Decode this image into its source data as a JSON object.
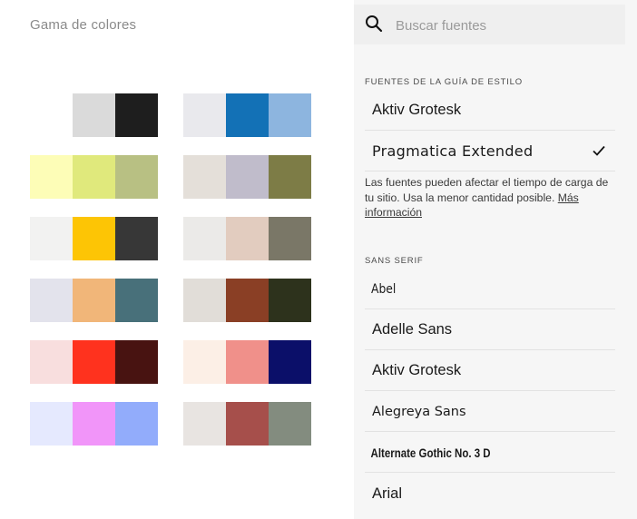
{
  "left_panel": {
    "title": "Gama de colores",
    "palettes": [
      [
        "#ffffff",
        "#dadada",
        "#1e1e1e"
      ],
      [
        "#e9e9ed",
        "#1371b6",
        "#8db5df"
      ],
      [
        "#fdfdb7",
        "#e0e97c",
        "#b8c083"
      ],
      [
        "#e4dfd9",
        "#c0bccb",
        "#7d7c46"
      ],
      [
        "#f2f2f1",
        "#fdc505",
        "#373737"
      ],
      [
        "#ebeae8",
        "#e2ccbf",
        "#7a7767"
      ],
      [
        "#e3e3ec",
        "#f1b679",
        "#48707a"
      ],
      [
        "#e1ddd8",
        "#8a3f25",
        "#2d321c"
      ],
      [
        "#f8dede",
        "#ff321e",
        "#481311"
      ],
      [
        "#fcefe6",
        "#f0908a",
        "#0b0f69"
      ],
      [
        "#e5e9fe",
        "#f195f9",
        "#92acfb"
      ],
      [
        "#e8e4e1",
        "#a64f4b",
        "#838c7f"
      ]
    ]
  },
  "search": {
    "placeholder": "Buscar fuentes",
    "value": ""
  },
  "style_guide": {
    "label": "FUENTES DE LA GUÍA DE ESTILO",
    "fonts": [
      {
        "name": "Aktiv Grotesk",
        "selected": false
      },
      {
        "name": "Pragmatica Extended",
        "selected": true
      }
    ],
    "notice_text": "Las fuentes pueden afectar el tiempo de carga de tu sitio. Usa la menor cantidad posible.",
    "notice_link": "Más información"
  },
  "sans_serif": {
    "label": "SANS SERIF",
    "fonts": [
      "Abel",
      "Adelle Sans",
      "Aktiv Grotesk",
      "Alegreya Sans",
      "Alternate Gothic No. 3 D",
      "Arial"
    ]
  },
  "icons": {
    "search": "search-icon",
    "check": "check-icon"
  }
}
